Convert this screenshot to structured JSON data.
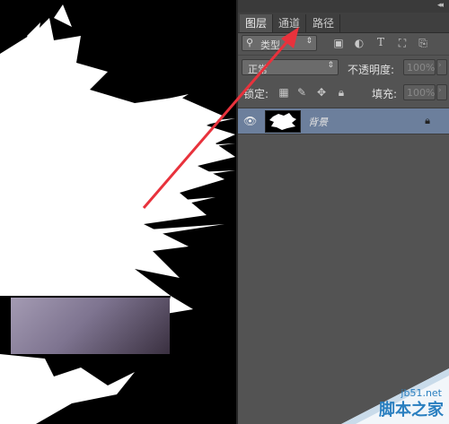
{
  "panel": {
    "tabs": [
      {
        "label": "图层",
        "active": true
      },
      {
        "label": "通道",
        "active": false
      },
      {
        "label": "路径",
        "active": false
      }
    ],
    "filter": {
      "icon": "search-icon",
      "value": "类型"
    },
    "blend_mode": {
      "value": "正常"
    },
    "opacity": {
      "label": "不透明度:",
      "value": "100%"
    },
    "lock": {
      "label": "锁定:"
    },
    "fill": {
      "label": "填充:",
      "value": "100%"
    },
    "layer": {
      "name": "背景",
      "visible": true,
      "locked": true
    }
  },
  "watermark": {
    "url": "jb51.net",
    "text": "脚本之家"
  },
  "colors": {
    "panel_bg": "#535353",
    "selected_layer": "#6c7f9c",
    "arrow": "#e8323c"
  }
}
